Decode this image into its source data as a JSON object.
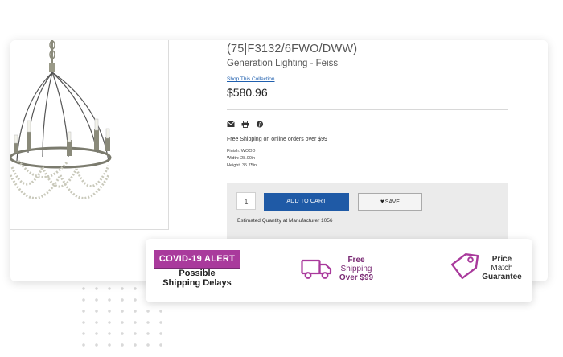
{
  "product": {
    "title": "(75|F3132/6FWO/DWW)",
    "brand": "Generation Lighting - Feiss",
    "collection_link": "Shop This Collection",
    "price": "$580.96",
    "shipping_note": "Free Shipping on online orders over $99",
    "specs": {
      "finish": "Finish: WOOD",
      "width": "Width: 28.00in",
      "height": "Height: 35.75in"
    }
  },
  "share_icons": [
    "email-icon",
    "print-icon",
    "pinterest-icon"
  ],
  "cart": {
    "quantity": "1",
    "add_label": "ADD TO CART",
    "save_label": "SAVE",
    "estimated": "Estimated Quantity at Manufacturer 1056"
  },
  "banner": {
    "covid_badge": "COVID-19 ALERT",
    "covid_line1": "Possible",
    "covid_line2": "Shipping Delays",
    "free_line1": "Free",
    "free_line2": "Shipping",
    "free_line3": "Over $99",
    "price_line1": "Price",
    "price_line2": "Match",
    "price_line3": "Guarantee"
  },
  "colors": {
    "accent": "#a93a9c",
    "button": "#1f5aa6",
    "link": "#1f5fae"
  }
}
